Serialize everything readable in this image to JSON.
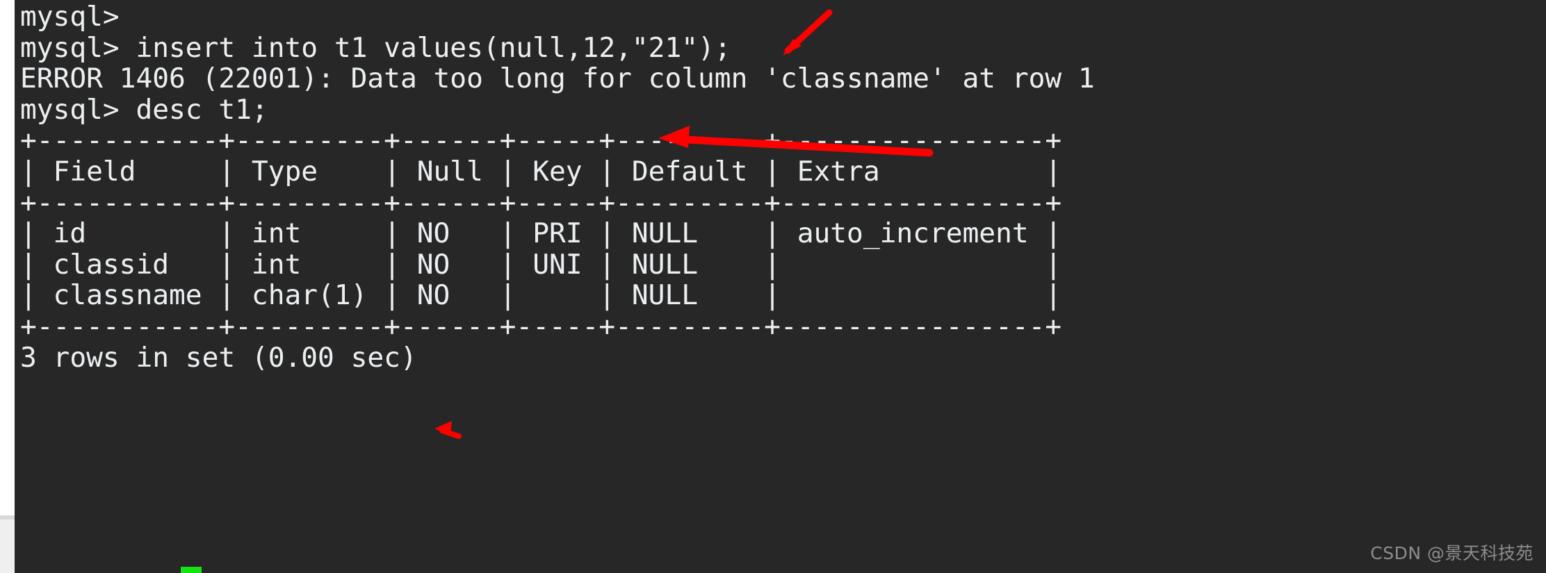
{
  "window": {
    "title": "mysql client terminal",
    "background_color": "#272727",
    "foreground_color": "#eceff1",
    "gutter_color": "#ffffff",
    "annotation_color": "#ff0000",
    "cursor_color": "#16e216"
  },
  "terminal": {
    "lines": [
      "mysql>",
      "mysql> insert into t1 values(null,12,\"21\");",
      "ERROR 1406 (22001): Data too long for column 'classname' at row 1",
      "mysql> desc t1;",
      "+-----------+---------+------+-----+---------+----------------+",
      "| Field     | Type    | Null | Key | Default | Extra          |",
      "+-----------+---------+------+-----+---------+----------------+",
      "| id        | int     | NO   | PRI | NULL    | auto_increment |",
      "| classid   | int     | NO   | UNI | NULL    |                |",
      "| classname | char(1) | NO   |     | NULL    |                |",
      "+-----------+---------+------+-----+---------+----------------+",
      "3 rows in set (0.00 sec)"
    ],
    "prompt": "mysql>",
    "commands": [
      "insert into t1 values(null,12,\"21\");",
      "desc t1;"
    ],
    "error": {
      "code": "ERROR 1406",
      "sqlstate": "(22001)",
      "message": "Data too long for column 'classname' at row 1"
    },
    "result_summary": "3 rows in set (0.00 sec)"
  },
  "desc_table": {
    "headers": [
      "Field",
      "Type",
      "Null",
      "Key",
      "Default",
      "Extra"
    ],
    "rows": [
      [
        "id",
        "int",
        "NO",
        "PRI",
        "NULL",
        "auto_increment"
      ],
      [
        "classid",
        "int",
        "NO",
        "UNI",
        "NULL",
        ""
      ],
      [
        "classname",
        "char(1)",
        "NO",
        "",
        "NULL",
        ""
      ]
    ]
  },
  "annotations": [
    {
      "name": "arrow-to-inserted-value",
      "description": "red arrow pointing down-left at the \"21\" string literal in the insert statement"
    },
    {
      "name": "arrow-to-error-message",
      "description": "red arrow pointing left at the ERROR 1406 too-long message"
    },
    {
      "name": "arrow-to-char-length",
      "description": "small red arrow pointing left at char(1) in the classname row"
    }
  ],
  "watermark": {
    "text": "CSDN @景天科技苑"
  }
}
